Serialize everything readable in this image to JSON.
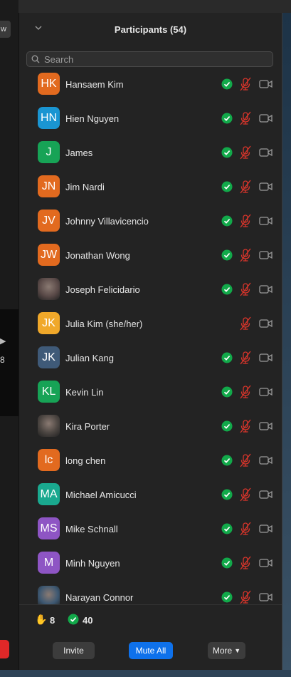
{
  "left": {
    "view_btn": "w",
    "tile_number": "8"
  },
  "panel": {
    "title": "Participants (54)"
  },
  "search": {
    "placeholder": "Search"
  },
  "participants": [
    {
      "initials": "HK",
      "name": "Hansaem Kim",
      "color": "#e26a1f",
      "has_check": true
    },
    {
      "initials": "HN",
      "name": "Hien Nguyen",
      "color": "#1a95d2",
      "has_check": true
    },
    {
      "initials": "J",
      "name": "James",
      "color": "#17a356",
      "has_check": true
    },
    {
      "initials": "JN",
      "name": "Jim Nardi",
      "color": "#e26a1f",
      "has_check": true
    },
    {
      "initials": "JV",
      "name": "Johnny Villavicencio",
      "color": "#e26a1f",
      "has_check": true
    },
    {
      "initials": "JW",
      "name": "Jonathan Wong",
      "color": "#e26a1f",
      "has_check": true
    },
    {
      "initials": "",
      "name": "Joseph Felicidario",
      "color": "#5a4a48",
      "photo": true,
      "has_check": true
    },
    {
      "initials": "JK",
      "name": "Julia Kim (she/her)",
      "color": "#f0a82a",
      "has_check": false
    },
    {
      "initials": "JK",
      "name": "Julian Kang",
      "color": "#3f5a78",
      "has_check": true
    },
    {
      "initials": "KL",
      "name": "Kevin Lin",
      "color": "#17a356",
      "has_check": true
    },
    {
      "initials": "",
      "name": "Kira Porter",
      "color": "#4b4541",
      "photo": true,
      "has_check": true
    },
    {
      "initials": "lc",
      "name": "long chen",
      "color": "#e26a1f",
      "has_check": true
    },
    {
      "initials": "MA",
      "name": "Michael Amicucci",
      "color": "#1aa98f",
      "has_check": true
    },
    {
      "initials": "MS",
      "name": "Mike Schnall",
      "color": "#8e55c4",
      "has_check": true
    },
    {
      "initials": "M",
      "name": "Minh Nguyen",
      "color": "#8e55c4",
      "has_check": true
    },
    {
      "initials": "",
      "name": "Narayan Connor",
      "color": "#3d5872",
      "photo": true,
      "has_check": true
    }
  ],
  "summary": {
    "raised_hands": "8",
    "yes_count": "40"
  },
  "footer": {
    "invite_label": "Invite",
    "mute_all_label": "Mute All",
    "more_label": "More"
  },
  "colors": {
    "check_green": "#12a94a",
    "mute_red": "#d8352b",
    "primary_blue": "#0e71eb"
  },
  "icons": {
    "check": "green-check-circle-icon",
    "mic": "microphone-muted-icon",
    "cam": "video-camera-icon",
    "hand": "raised-hand-icon"
  }
}
